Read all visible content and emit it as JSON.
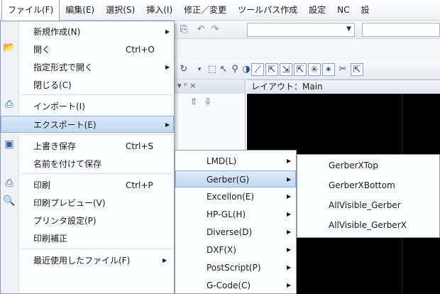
{
  "menubar": {
    "items": [
      "ファイル(F)",
      "編集(E)",
      "選択(S)",
      "挿入(I)",
      "修正／変更",
      "ツールパス作成",
      "設定",
      "NC",
      "設"
    ]
  },
  "file_menu": {
    "items": [
      {
        "label": "新規作成(N)",
        "shortcut": "",
        "submenu": true,
        "icon": ""
      },
      {
        "label": "開く",
        "shortcut": "Ctrl+O",
        "submenu": false,
        "icon": "open-folder-icon"
      },
      {
        "label": "指定形式で開く",
        "shortcut": "",
        "submenu": true,
        "icon": ""
      },
      {
        "label": "閉じる(C)",
        "shortcut": "",
        "submenu": false,
        "icon": ""
      },
      {
        "label": "インポート(I)",
        "shortcut": "",
        "submenu": false,
        "icon": "import-icon"
      },
      {
        "label": "エクスポート(E)",
        "shortcut": "",
        "submenu": true,
        "icon": "",
        "highlighted": true
      },
      {
        "label": "上書き保存",
        "shortcut": "Ctrl+S",
        "submenu": false,
        "icon": "save-icon"
      },
      {
        "label": "名前を付けて保存",
        "shortcut": "",
        "submenu": false,
        "icon": ""
      },
      {
        "label": "印刷",
        "shortcut": "Ctrl+P",
        "submenu": false,
        "icon": "print-icon"
      },
      {
        "label": "印刷プレビュー(V)",
        "shortcut": "",
        "submenu": false,
        "icon": "print-preview-icon"
      },
      {
        "label": "プリンタ設定(P)",
        "shortcut": "",
        "submenu": false,
        "icon": ""
      },
      {
        "label": "印刷補正",
        "shortcut": "",
        "submenu": false,
        "icon": ""
      },
      {
        "label": "最近使用したファイル(F)",
        "shortcut": "",
        "submenu": true,
        "icon": ""
      }
    ]
  },
  "export_menu": {
    "items": [
      {
        "label": "LMD(L)"
      },
      {
        "label": "Gerber(G)",
        "highlighted": true
      },
      {
        "label": "Excellon(E)"
      },
      {
        "label": "HP-GL(H)"
      },
      {
        "label": "Diverse(D)"
      },
      {
        "label": "DXF(X)"
      },
      {
        "label": "PostScript(P)"
      },
      {
        "label": "G-Code(C)"
      }
    ]
  },
  "gerber_menu": {
    "items": [
      "GerberXTop",
      "GerberXBottom",
      "AllVisible_Gerber",
      "AllVisible_GerberX"
    ]
  },
  "panel": {
    "pin": "▾ ᵖ ×",
    "layout_tab": "レイアウト：Main"
  },
  "colors": {
    "highlight": "#c2d9f2",
    "canvas": "#000000"
  }
}
